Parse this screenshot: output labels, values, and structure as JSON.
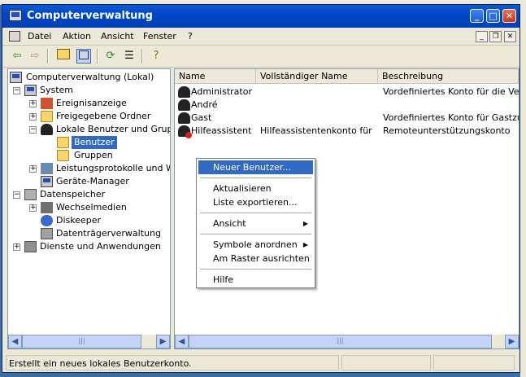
{
  "window": {
    "title": "Computerverwaltung"
  },
  "menubar": {
    "items": [
      "Datei",
      "Aktion",
      "Ansicht",
      "Fenster",
      "?"
    ]
  },
  "toolbar": {
    "icons": [
      "back-arrow-icon",
      "forward-arrow-icon",
      "up-folder-icon",
      "show-hide-tree-icon",
      "refresh-icon",
      "export-list-icon",
      "help-icon"
    ]
  },
  "tree": {
    "root": "Computerverwaltung (Lokal)",
    "items": [
      {
        "label": "System"
      },
      {
        "label": "Ereignisanzeige"
      },
      {
        "label": "Freigegebene Ordner"
      },
      {
        "label": "Lokale Benutzer und Gruppen"
      },
      {
        "label": "Benutzer"
      },
      {
        "label": "Gruppen"
      },
      {
        "label": "Leistungsprotokolle und Warnungen"
      },
      {
        "label": "Geräte-Manager"
      },
      {
        "label": "Datenspeicher"
      },
      {
        "label": "Wechselmedien"
      },
      {
        "label": "Diskeeper"
      },
      {
        "label": "Datenträgerverwaltung"
      },
      {
        "label": "Dienste und Anwendungen"
      }
    ]
  },
  "list": {
    "columns": [
      "Name",
      "Vollständiger Name",
      "Beschreibung"
    ],
    "rows": [
      {
        "name": "Administrator",
        "full": "",
        "desc": "Vordefiniertes Konto für die Verwaltung"
      },
      {
        "name": "André",
        "full": "",
        "desc": ""
      },
      {
        "name": "Gast",
        "full": "",
        "desc": "Vordefiniertes Konto für Gastzugriff"
      },
      {
        "name": "Hilfeassistent",
        "full": "Hilfeassistentenkonto für ...",
        "desc": "Remoteunterstützungskonto"
      }
    ]
  },
  "context_menu": {
    "items": [
      "Neuer Benutzer...",
      "Aktualisieren",
      "Liste exportieren...",
      "Ansicht",
      "Symbole anordnen",
      "Am Raster ausrichten",
      "Hilfe"
    ]
  },
  "statusbar": {
    "text": "Erstellt ein neues lokales Benutzerkonto."
  },
  "colors": {
    "titlebar": "#0046c8",
    "selection": "#316ac5",
    "face": "#ece9d8"
  }
}
